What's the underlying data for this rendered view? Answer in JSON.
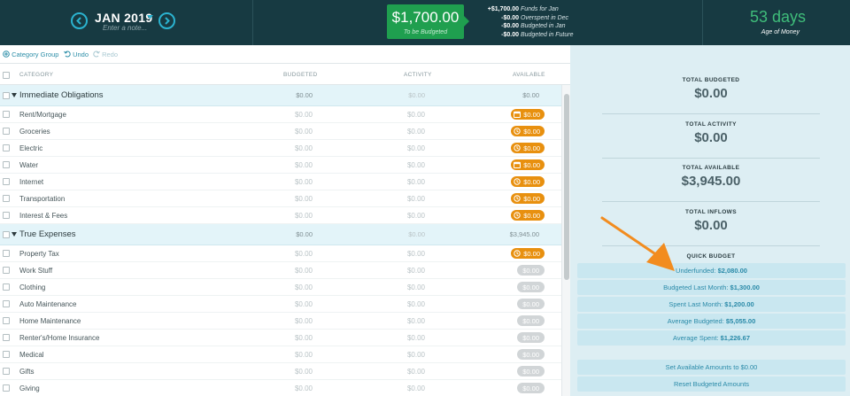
{
  "header": {
    "month": "JAN 2019",
    "note_placeholder": "Enter a note...",
    "to_be_budgeted": {
      "amount": "$1,700.00",
      "label": "To be Budgeted"
    },
    "breakdown": [
      {
        "amount": "+$1,700.00",
        "label": "Funds for Jan"
      },
      {
        "amount": "-$0.00",
        "label": "Overspent in Dec"
      },
      {
        "amount": "-$0.00",
        "label": "Budgeted in Jan"
      },
      {
        "amount": "-$0.00",
        "label": "Budgeted in Future"
      }
    ],
    "age_of_money": {
      "value": "53 days",
      "label": "Age of Money"
    }
  },
  "toolbar": {
    "category_group": "Category Group",
    "undo": "Undo",
    "redo": "Redo"
  },
  "columns": {
    "category": "CATEGORY",
    "budgeted": "BUDGETED",
    "activity": "ACTIVITY",
    "available": "AVAILABLE"
  },
  "groups": [
    {
      "name": "Immediate Obligations",
      "budgeted": "$0.00",
      "activity": "$0.00",
      "available": "$0.00",
      "categories": [
        {
          "name": "Rent/Mortgage",
          "budgeted": "$0.00",
          "activity": "$0.00",
          "available": "$0.00",
          "style": "orange",
          "icon": "calendar-icon"
        },
        {
          "name": "Groceries",
          "budgeted": "$0.00",
          "activity": "$0.00",
          "available": "$0.00",
          "style": "orange",
          "icon": "clock-icon"
        },
        {
          "name": "Electric",
          "budgeted": "$0.00",
          "activity": "$0.00",
          "available": "$0.00",
          "style": "orange",
          "icon": "clock-icon"
        },
        {
          "name": "Water",
          "budgeted": "$0.00",
          "activity": "$0.00",
          "available": "$0.00",
          "style": "orange",
          "icon": "calendar-icon"
        },
        {
          "name": "Internet",
          "budgeted": "$0.00",
          "activity": "$0.00",
          "available": "$0.00",
          "style": "orange",
          "icon": "clock-icon"
        },
        {
          "name": "Transportation",
          "budgeted": "$0.00",
          "activity": "$0.00",
          "available": "$0.00",
          "style": "orange",
          "icon": "clock-icon"
        },
        {
          "name": "Interest & Fees",
          "budgeted": "$0.00",
          "activity": "$0.00",
          "available": "$0.00",
          "style": "orange",
          "icon": "clock-icon"
        }
      ]
    },
    {
      "name": "True Expenses",
      "budgeted": "$0.00",
      "activity": "$0.00",
      "available": "$3,945.00",
      "categories": [
        {
          "name": "Property Tax",
          "budgeted": "$0.00",
          "activity": "$0.00",
          "available": "$0.00",
          "style": "orange",
          "icon": "clock-icon"
        },
        {
          "name": "Work Stuff",
          "budgeted": "$0.00",
          "activity": "$0.00",
          "available": "$0.00",
          "style": "gray",
          "icon": ""
        },
        {
          "name": "Clothing",
          "budgeted": "$0.00",
          "activity": "$0.00",
          "available": "$0.00",
          "style": "gray",
          "icon": ""
        },
        {
          "name": "Auto Maintenance",
          "budgeted": "$0.00",
          "activity": "$0.00",
          "available": "$0.00",
          "style": "gray",
          "icon": "clock-icon"
        },
        {
          "name": "Home Maintenance",
          "budgeted": "$0.00",
          "activity": "$0.00",
          "available": "$0.00",
          "style": "gray",
          "icon": ""
        },
        {
          "name": "Renter's/Home Insurance",
          "budgeted": "$0.00",
          "activity": "$0.00",
          "available": "$0.00",
          "style": "gray",
          "icon": ""
        },
        {
          "name": "Medical",
          "budgeted": "$0.00",
          "activity": "$0.00",
          "available": "$0.00",
          "style": "gray",
          "icon": "clock-icon"
        },
        {
          "name": "Gifts",
          "budgeted": "$0.00",
          "activity": "$0.00",
          "available": "$0.00",
          "style": "gray",
          "icon": ""
        },
        {
          "name": "Giving",
          "budgeted": "$0.00",
          "activity": "$0.00",
          "available": "$0.00",
          "style": "gray",
          "icon": "clock-icon"
        }
      ]
    }
  ],
  "inspector": {
    "stats": [
      {
        "label": "TOTAL BUDGETED",
        "value": "$0.00"
      },
      {
        "label": "TOTAL ACTIVITY",
        "value": "$0.00"
      },
      {
        "label": "TOTAL AVAILABLE",
        "value": "$3,945.00"
      },
      {
        "label": "TOTAL INFLOWS",
        "value": "$0.00"
      }
    ],
    "quick_budget_title": "QUICK BUDGET",
    "quick_budget": [
      {
        "label": "Underfunded:",
        "amount": "$2,080.00"
      },
      {
        "label": "Budgeted Last Month:",
        "amount": "$1,300.00"
      },
      {
        "label": "Spent Last Month:",
        "amount": "$1,200.00"
      },
      {
        "label": "Average Budgeted:",
        "amount": "$5,055.00"
      },
      {
        "label": "Average Spent:",
        "amount": "$1,226.67"
      }
    ],
    "actions": [
      {
        "label": "Set Available Amounts to $0.00"
      },
      {
        "label": "Reset Budgeted Amounts"
      }
    ]
  },
  "colors": {
    "header_bg": "#173a42",
    "tbb_green": "#1f9f4f",
    "accent_blue": "#2bb3d0",
    "pill_orange": "#e8900f",
    "arrow_orange": "#f28c1f",
    "inspector_bg": "#ddeef3"
  }
}
